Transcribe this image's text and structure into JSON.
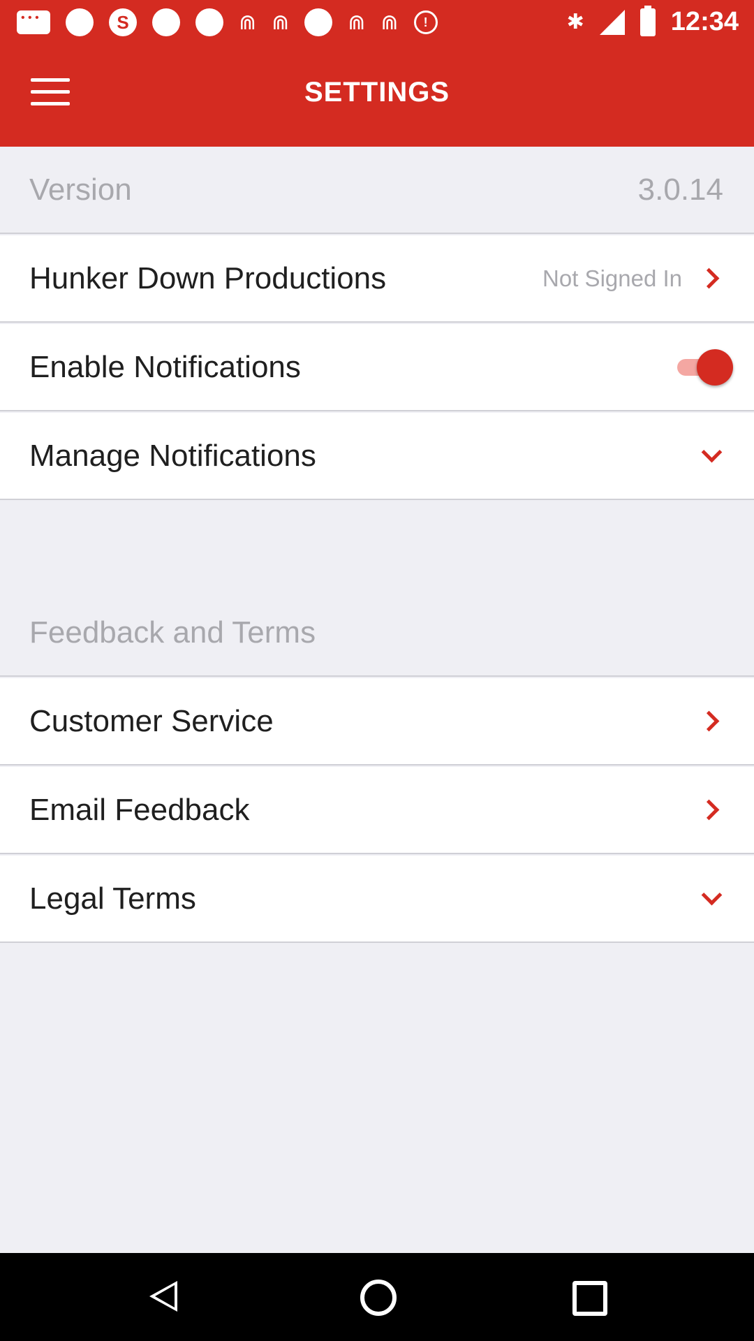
{
  "status_bar": {
    "time": "12:34",
    "icons": [
      "message-icon",
      "notification-dot-icon",
      "s-app-icon",
      "notification-dot-icon",
      "notification-dot-icon",
      "fan-icon",
      "fan-icon",
      "notification-dot-icon",
      "fan-icon",
      "fan-icon",
      "alert-icon",
      "bluetooth-icon",
      "signal-icon",
      "battery-icon"
    ],
    "alert_symbol": "!"
  },
  "app_bar": {
    "title": "SETTINGS",
    "menu_icon": "hamburger-menu-icon",
    "color": "#d42b21"
  },
  "settings": {
    "version_label": "Version",
    "version_value": "3.0.14",
    "account_label": "Hunker Down Productions",
    "account_status": "Not Signed In",
    "enable_notifications_label": "Enable Notifications",
    "enable_notifications_on": true,
    "manage_notifications_label": "Manage Notifications",
    "section_feedback": "Feedback and Terms",
    "customer_service_label": "Customer Service",
    "email_feedback_label": "Email Feedback",
    "legal_terms_label": "Legal Terms"
  },
  "nav_bar": {
    "back_icon": "back-triangle-icon",
    "home_icon": "home-circle-icon",
    "recents_icon": "recents-square-icon"
  }
}
